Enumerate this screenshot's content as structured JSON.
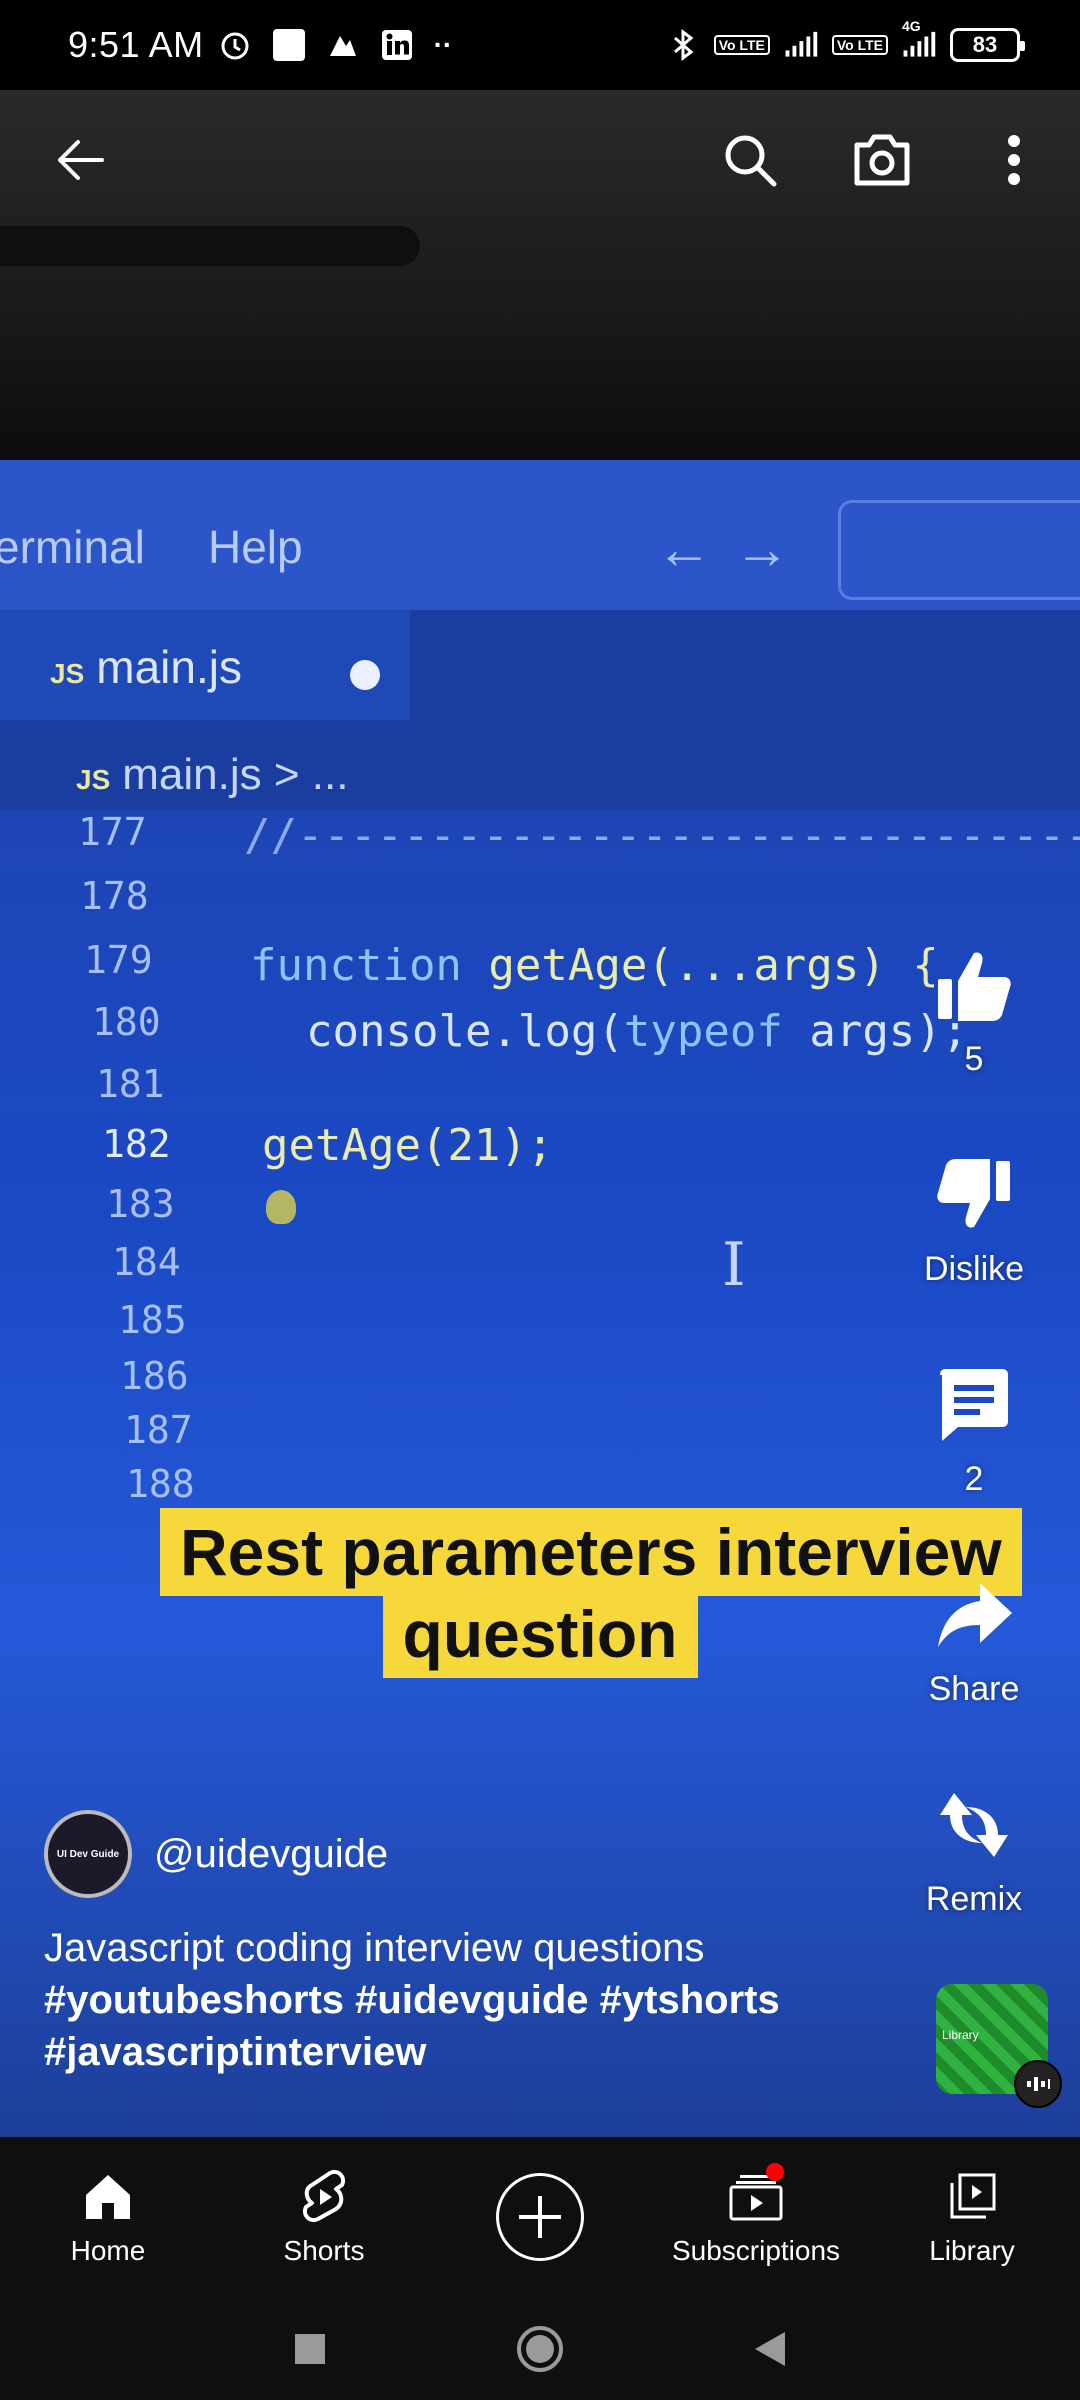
{
  "status_bar": {
    "time": "9:51 AM",
    "battery": "83",
    "network": "4G",
    "lte": "Vo LTE",
    "dots": "··"
  },
  "top_bar": {
    "back_icon": "arrow-left-icon",
    "search_icon": "search-icon",
    "camera_icon": "camera-icon",
    "more_icon": "more-vert-icon"
  },
  "video": {
    "editor_menu": [
      "erminal",
      "Help"
    ],
    "tab_label": "main.js",
    "js_tag": "JS",
    "breadcrumb": "main.js > ...",
    "line_numbers": [
      "177",
      "178",
      "179",
      "180",
      "181",
      "182",
      "183",
      "184",
      "185",
      "186",
      "187",
      "188"
    ],
    "code": {
      "l177": "//---------------------------------",
      "l179_kw": "function",
      "l179_rest": " getAge(...args) {",
      "l180_a": "console.log(",
      "l180_kw": "typeof",
      "l180_b": " args);",
      "l182": "getAge(21);"
    },
    "caption_line1": "Rest parameters interview",
    "caption_line2": "question"
  },
  "actions": {
    "like_count": "5",
    "dislike_label": "Dislike",
    "comment_count": "2",
    "share_label": "Share",
    "remix_label": "Remix"
  },
  "channel": {
    "handle": "@uidevguide",
    "avatar_text": "UI Dev Guide"
  },
  "description": {
    "title": "Javascript coding interview questions",
    "hashtags": "#youtubeshorts #uidevguide #ytshorts #javascriptinterview"
  },
  "sound": {
    "label": "Library"
  },
  "bottom_nav": {
    "home": "Home",
    "shorts": "Shorts",
    "subscriptions": "Subscriptions",
    "library": "Library"
  }
}
